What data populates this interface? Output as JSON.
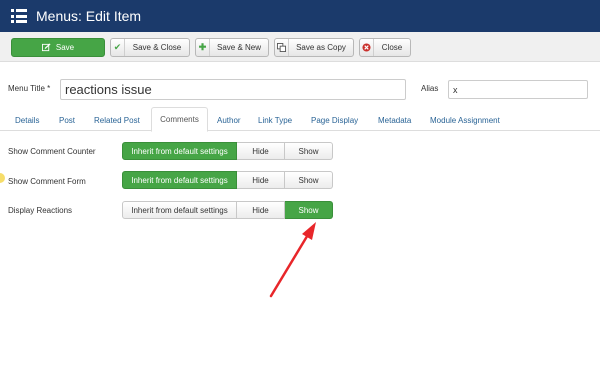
{
  "header": {
    "title": "Menus: Edit Item",
    "icon": "menu-list-icon"
  },
  "toolbar": {
    "save": "Save",
    "save_close": "Save & Close",
    "save_new": "Save & New",
    "save_copy": "Save as Copy",
    "close": "Close"
  },
  "form": {
    "menu_title_label": "Menu Title *",
    "menu_title_value": "reactions issue",
    "alias_label": "Alias",
    "alias_value": "x"
  },
  "tabs": [
    "Details",
    "Post",
    "Related Post",
    "Comments",
    "Author",
    "Link Type",
    "Page Display",
    "Metadata",
    "Module Assignment"
  ],
  "active_tab": "Comments",
  "options": [
    {
      "label": "Show Comment Counter",
      "choices": [
        "Inherit from default settings",
        "Hide",
        "Show"
      ],
      "selected": "Inherit from default settings"
    },
    {
      "label": "Show Comment Form",
      "choices": [
        "Inherit from default settings",
        "Hide",
        "Show"
      ],
      "selected": "Inherit from default settings"
    },
    {
      "label": "Display Reactions",
      "choices": [
        "Inherit from default settings",
        "Hide",
        "Show"
      ],
      "selected": "Show"
    }
  ],
  "colors": {
    "header_bg": "#1b3a6b",
    "accent_green": "#46a546",
    "annotation_arrow": "#e8262a",
    "link": "#2a6496"
  }
}
